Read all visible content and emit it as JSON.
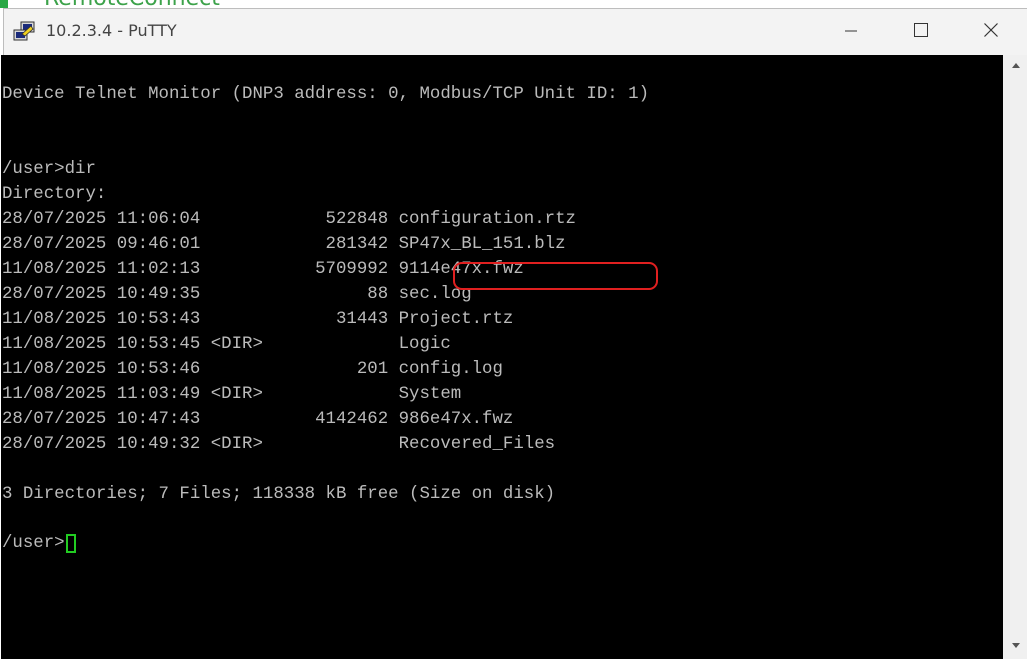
{
  "background_window": {
    "partial_text": "RemoteConnect"
  },
  "window": {
    "title": "10.2.3.4 - PuTTY",
    "app_icon": "putty-icon",
    "controls": {
      "minimize_icon": "minimize-icon",
      "maximize_icon": "maximize-icon",
      "close_icon": "close-icon"
    }
  },
  "terminal": {
    "lines": [
      "Device Telnet Monitor (DNP3 address: 0, Modbus/TCP Unit ID: 1)",
      "",
      "",
      "/user>dir",
      "Directory:",
      "28/07/2025 11:06:04            522848 configuration.rtz",
      "28/07/2025 09:46:01            281342 SP47x_BL_151.blz",
      "11/08/2025 11:02:13           5709992 9114e47x.fwz",
      "28/07/2025 10:49:35                88 sec.log",
      "11/08/2025 10:53:43             31443 Project.rtz",
      "11/08/2025 10:53:45 <DIR>             Logic",
      "11/08/2025 10:53:46               201 config.log",
      "11/08/2025 11:03:49 <DIR>             System",
      "28/07/2025 10:47:43           4142462 986e47x.fwz",
      "28/07/2025 10:49:32 <DIR>             Recovered_Files",
      "",
      "3 Directories; 7 Files; 118338 kB free (Size on disk)",
      "",
      "/user>"
    ],
    "prompt": "/user>",
    "highlighted_file": "9114e47x.fwz",
    "colors": {
      "background": "#000000",
      "text": "#bbbbbb",
      "cursor": "#22cc22",
      "highlight": "#e02020"
    }
  },
  "scrollbar": {
    "up_icon": "scroll-up-arrow-icon",
    "down_icon": "scroll-down-arrow-icon"
  }
}
